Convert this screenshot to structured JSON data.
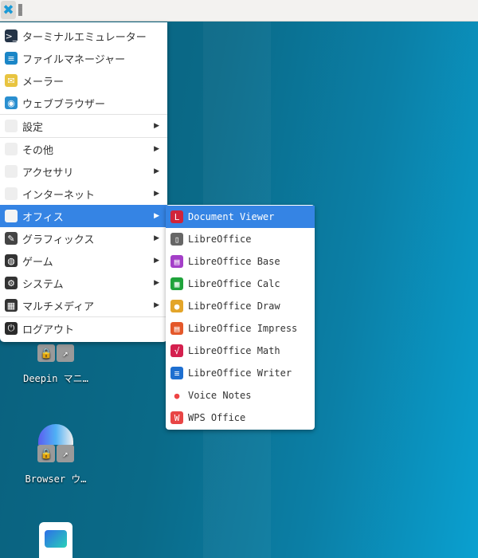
{
  "main_menu": [
    {
      "label": "ターミナルエミュレーター",
      "icon": "terminal-icon",
      "color": "#243447",
      "glyph": ">_"
    },
    {
      "label": "ファイルマネージャー",
      "icon": "file-manager-icon",
      "color": "#1b86c7",
      "glyph": "≡"
    },
    {
      "label": "メーラー",
      "icon": "mail-icon",
      "color": "#e8c440",
      "glyph": "✉"
    },
    {
      "label": "ウェブブラウザー",
      "icon": "web-browser-icon",
      "color": "#2a8fd0",
      "glyph": "◉"
    },
    {
      "sep": true
    },
    {
      "label": "設定",
      "icon": "settings-folder-icon",
      "color": "#eee",
      "glyph": "",
      "submenu": true
    },
    {
      "sep": true
    },
    {
      "label": "その他",
      "icon": "other-folder-icon",
      "color": "#eee",
      "glyph": "",
      "submenu": true
    },
    {
      "label": "アクセサリ",
      "icon": "accessories-folder-icon",
      "color": "#eee",
      "glyph": "",
      "submenu": true
    },
    {
      "label": "インターネット",
      "icon": "internet-folder-icon",
      "color": "#eee",
      "glyph": "",
      "submenu": true
    },
    {
      "label": "オフィス",
      "icon": "office-folder-icon",
      "color": "#f4f4f4",
      "glyph": "",
      "submenu": true,
      "active": true
    },
    {
      "label": "グラフィックス",
      "icon": "graphics-icon",
      "color": "#444",
      "glyph": "✎",
      "submenu": true
    },
    {
      "label": "ゲーム",
      "icon": "gamepad-icon",
      "color": "#333",
      "glyph": "◍",
      "submenu": true
    },
    {
      "label": "システム",
      "icon": "gear-icon",
      "color": "#333",
      "glyph": "⚙",
      "submenu": true
    },
    {
      "label": "マルチメディア",
      "icon": "film-icon",
      "color": "#333",
      "glyph": "▦",
      "submenu": true
    },
    {
      "sep": true
    },
    {
      "label": "ログアウト",
      "icon": "logout-icon",
      "color": "#2b2b2b",
      "glyph": "⏻"
    }
  ],
  "office_submenu": [
    {
      "label": "Document Viewer",
      "icon": "document-viewer-icon",
      "color": "#d0243a",
      "glyph": "L",
      "active": true
    },
    {
      "label": "LibreOffice",
      "icon": "libreoffice-icon",
      "color": "#666",
      "glyph": "▯"
    },
    {
      "label": "LibreOffice Base",
      "icon": "libreoffice-base-icon",
      "color": "#a43fc8",
      "glyph": "▤"
    },
    {
      "label": "LibreOffice Calc",
      "icon": "libreoffice-calc-icon",
      "color": "#1fa33b",
      "glyph": "▦"
    },
    {
      "label": "LibreOffice Draw",
      "icon": "libreoffice-draw-icon",
      "color": "#e3a52a",
      "glyph": "●"
    },
    {
      "label": "LibreOffice Impress",
      "icon": "libreoffice-impress-icon",
      "color": "#e4582a",
      "glyph": "▤"
    },
    {
      "label": "LibreOffice Math",
      "icon": "libreoffice-math-icon",
      "color": "#d4204e",
      "glyph": "√"
    },
    {
      "label": "LibreOffice Writer",
      "icon": "libreoffice-writer-icon",
      "color": "#1e6fd0",
      "glyph": "≡"
    },
    {
      "label": "Voice Notes",
      "icon": "voice-notes-icon",
      "color": "#fff",
      "glyph": "●"
    },
    {
      "label": "WPS Office",
      "icon": "wps-office-icon",
      "color": "#e84545",
      "glyph": "W"
    }
  ],
  "desktop": [
    {
      "label": "Deepin マニ…"
    },
    {
      "label": "Browser ウ…"
    }
  ],
  "topbar": {
    "app_glyph": "✖"
  }
}
